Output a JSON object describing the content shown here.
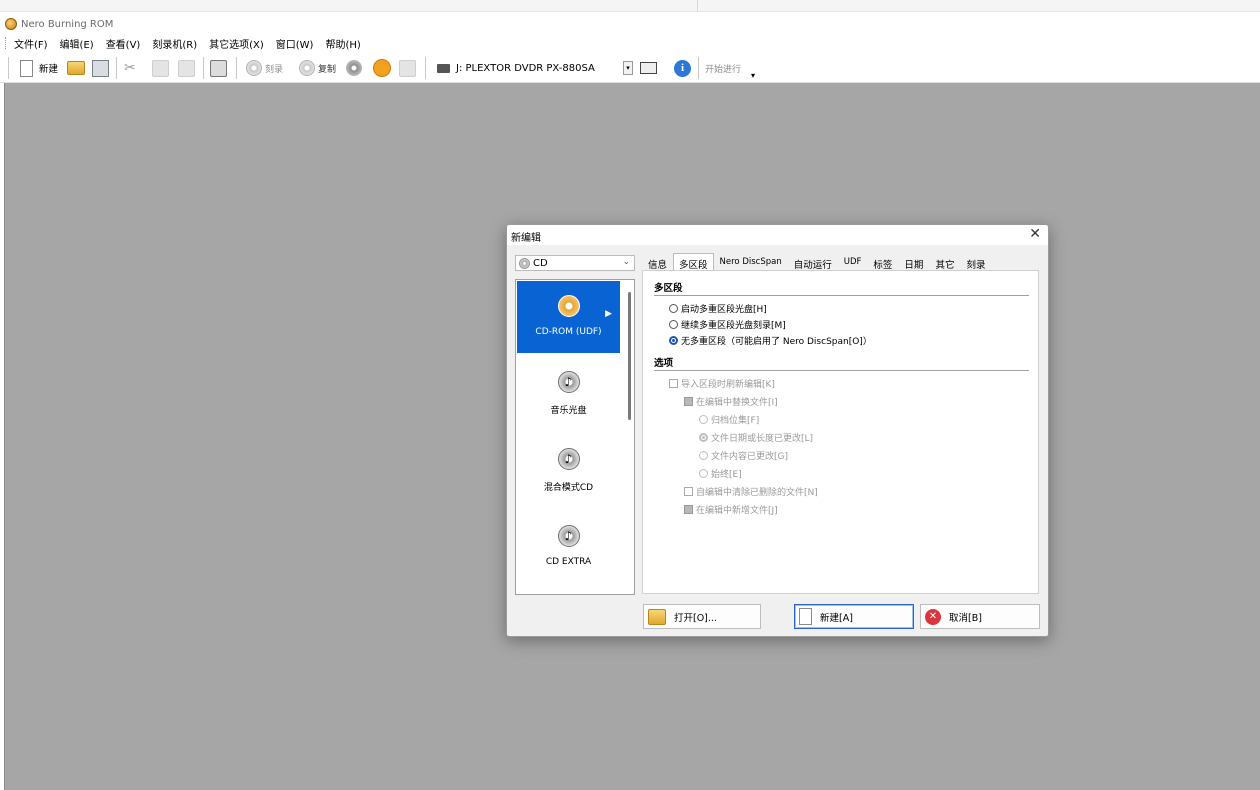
{
  "app": {
    "title": "Nero Burning ROM"
  },
  "menu": [
    "文件(F)",
    "编辑(E)",
    "查看(V)",
    "刻录机(R)",
    "其它选项(X)",
    "窗口(W)",
    "帮助(H)"
  ],
  "toolbar": {
    "new_label": "新建",
    "burn_label": "刻录",
    "copy_label": "复制",
    "drive_label": "J: PLEXTOR DVDR   PX-880SA",
    "start_label": "开始进行"
  },
  "dialog": {
    "title": "新编辑",
    "disc_type": "CD",
    "compilations": [
      {
        "label": "CD-ROM (UDF)",
        "selected": true
      },
      {
        "label": "音乐光盘",
        "selected": false
      },
      {
        "label": "混合模式CD",
        "selected": false
      },
      {
        "label": "CD EXTRA",
        "selected": false
      }
    ],
    "tabs": [
      "信息",
      "多区段",
      "Nero DiscSpan",
      "自动运行",
      "UDF",
      "标签",
      "日期",
      "其它",
      "刻录"
    ],
    "active_tab": "多区段",
    "multisession": {
      "heading": "多区段",
      "options": [
        {
          "label": "启动多重区段光盘[H]",
          "checked": false
        },
        {
          "label": "继续多重区段光盘刻录[M]",
          "checked": false
        },
        {
          "label": "无多重区段（可能启用了 Nero DiscSpan[O]）",
          "checked": true
        }
      ]
    },
    "options": {
      "heading": "选项",
      "import_label": "导入区段时刷新编辑[K]",
      "replace_label": "在编辑中替换文件[I]",
      "replace_sub": [
        {
          "label": "归档位集[F]",
          "checked": false
        },
        {
          "label": "文件日期或长度已更改[L]",
          "checked": true
        },
        {
          "label": "文件内容已更改[G]",
          "checked": false
        },
        {
          "label": "始终[E]",
          "checked": false
        }
      ],
      "remove_label": "自编辑中清除已删除的文件[N]",
      "add_label": "在编辑中新增文件[J]"
    },
    "buttons": {
      "open": "打开[O]...",
      "new": "新建[A]",
      "cancel": "取消[B]"
    }
  }
}
